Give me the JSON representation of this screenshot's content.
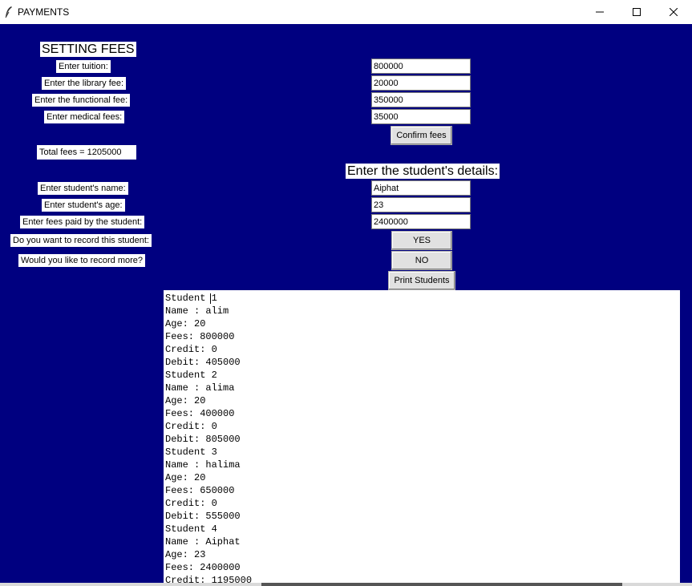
{
  "window": {
    "title": "PAYMENTS",
    "icons": {
      "app": "feather-icon",
      "minimize": "minimize-icon",
      "maximize": "maximize-icon",
      "close": "close-icon"
    }
  },
  "fees_section": {
    "heading": "SETTING FEES",
    "tuition_label": "Enter tuition:",
    "library_label": "Enter the library fee:",
    "functional_label": "Enter the functional fee:",
    "medical_label": "Enter medical fees:",
    "tuition_value": "800000",
    "library_value": "20000",
    "functional_value": "350000",
    "medical_value": "35000",
    "confirm_button": "Confirm fees",
    "total_text": "Total fees = 1205000"
  },
  "student_section": {
    "heading": "Enter the student's details:",
    "name_label": "Enter student's name:",
    "age_label": "Enter student's age:",
    "fees_label": "Enter fees paid by the student:",
    "record_label": "Do you want to record this student:",
    "more_label": "Would you like to record more?",
    "name_value": "Aiphat",
    "age_value": "23",
    "fees_value": "2400000",
    "yes_button": "YES",
    "no_button": "NO",
    "print_button": "Print Students"
  },
  "output_text": "Student 1\nName : alim\nAge: 20\nFees: 800000\nCredit: 0\nDebit: 405000\nStudent 2\nName : alima\nAge: 20\nFees: 400000\nCredit: 0\nDebit: 805000\nStudent 3\nName : halima\nAge: 20\nFees: 650000\nCredit: 0\nDebit: 555000\nStudent 4\nName : Aiphat\nAge: 23\nFees: 2400000\nCredit: 1195000",
  "colors": {
    "background": "#000080",
    "label_bg": "#ffffff",
    "button_bg": "#e1e1e1"
  }
}
